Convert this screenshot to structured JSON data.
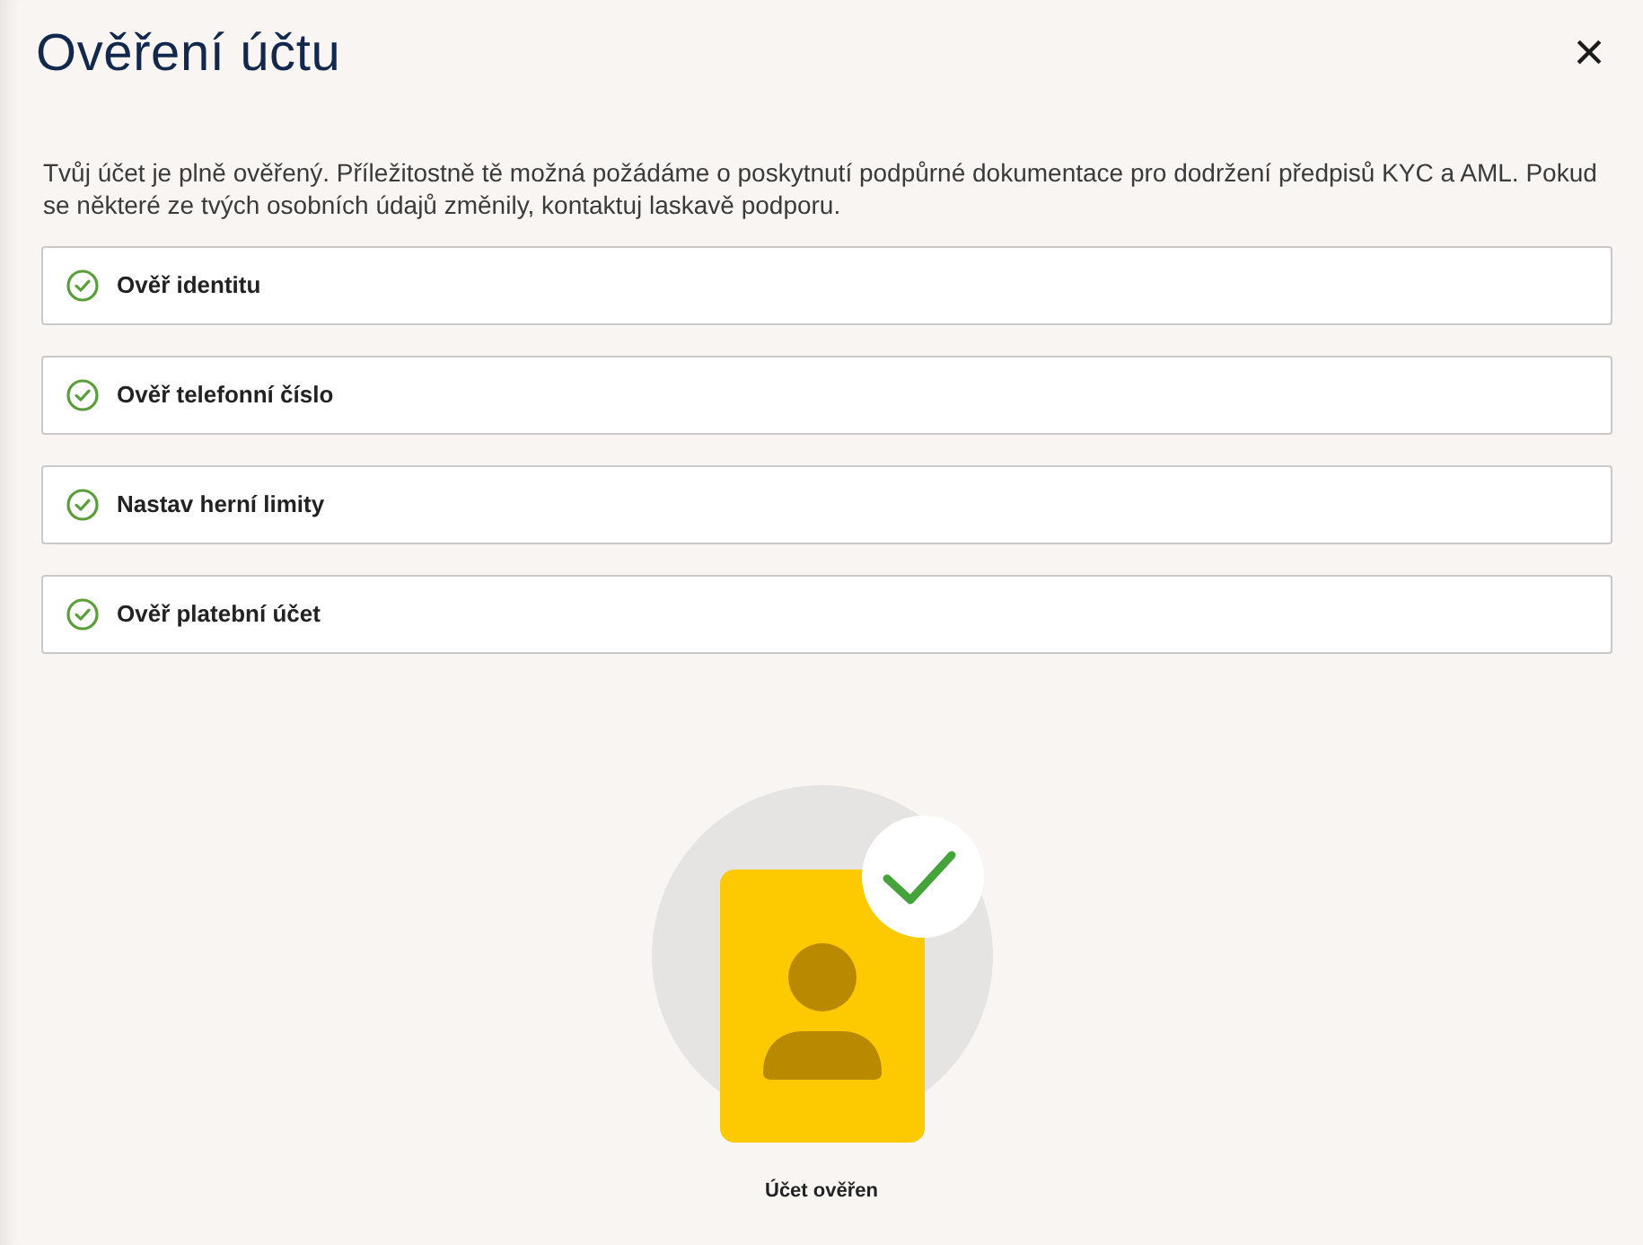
{
  "dialog": {
    "title": "Ověření účtu",
    "close": "×"
  },
  "intro": "Tvůj účet je plně ověřený. Příležitostně tě možná požádáme o poskytnutí podpůrné dokumentace pro dodržení předpisů KYC a AML. Pokud se některé ze tvých osobních údajů změnily, kontaktuj laskavě podporu.",
  "steps": [
    {
      "label": "Ověř identitu",
      "done": true
    },
    {
      "label": "Ověř telefonní číslo",
      "done": true
    },
    {
      "label": "Nastav herní limity",
      "done": true
    },
    {
      "label": "Ověř platební účet",
      "done": true
    }
  ],
  "status": {
    "caption": "Účet ověřen",
    "verified": true
  }
}
